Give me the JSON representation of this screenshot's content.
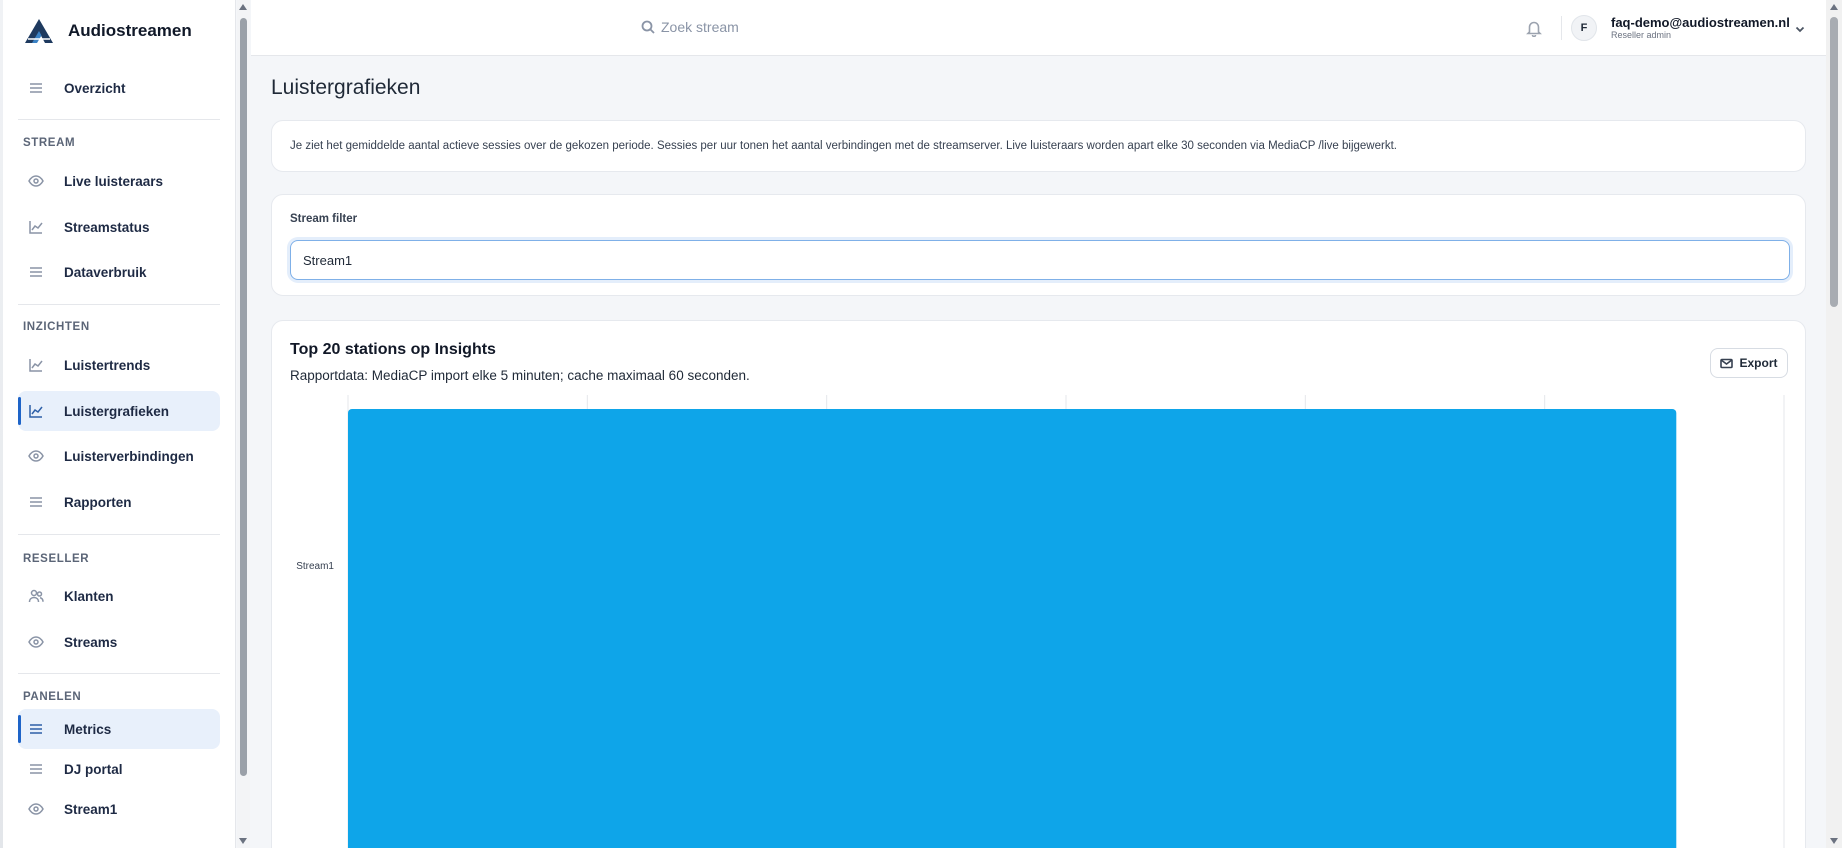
{
  "app": {
    "name": "Audiostreamen",
    "brand_color": "#1e3a5f"
  },
  "sidebar": {
    "overview": {
      "label": "Overzicht",
      "icon": "menu-icon"
    },
    "sections": [
      {
        "label": "STREAM",
        "items": [
          {
            "label": "Live luisteraars",
            "icon": "eye-icon"
          },
          {
            "label": "Streamstatus",
            "icon": "chart-line-icon"
          },
          {
            "label": "Dataverbruik",
            "icon": "menu-icon"
          }
        ]
      },
      {
        "label": "INZICHTEN",
        "items": [
          {
            "label": "Luistertrends",
            "icon": "chart-line-icon"
          },
          {
            "label": "Luistergrafieken",
            "icon": "chart-line-icon",
            "active": true
          },
          {
            "label": "Luisterverbindingen",
            "icon": "eye-icon"
          },
          {
            "label": "Rapporten",
            "icon": "menu-icon"
          }
        ]
      },
      {
        "label": "RESELLER",
        "items": [
          {
            "label": "Klanten",
            "icon": "users-icon"
          },
          {
            "label": "Streams",
            "icon": "eye-icon"
          }
        ]
      },
      {
        "label": "PANELEN",
        "items": [
          {
            "label": "Metrics",
            "icon": "menu-icon",
            "active": true
          },
          {
            "label": "DJ portal",
            "icon": "menu-icon"
          },
          {
            "label": "Stream1",
            "icon": "eye-icon"
          }
        ]
      }
    ]
  },
  "topbar": {
    "search_placeholder": "Zoek stream",
    "user": {
      "initial": "F",
      "email": "faq-demo@audiostreamen.nl",
      "role": "Reseller admin"
    }
  },
  "main": {
    "page_title": "Luistergrafieken",
    "info_text": "Je ziet het gemiddelde aantal actieve sessies over de gekozen periode. Sessies per uur tonen het aantal verbindingen met de streamserver. Live luisteraars worden apart elke 30 seconden via MediaCP /live bijgewerkt.",
    "filter": {
      "label": "Stream filter",
      "value": "Stream1"
    },
    "chart_card": {
      "title": "Top 20 stations op Insights",
      "subtitle": "Rapportdata: MediaCP import elke 5 minuten; cache maximaal 60 seconden.",
      "export_label": "Export"
    }
  },
  "chart_data": {
    "type": "bar",
    "orientation": "horizontal",
    "title": "Top 20 stations op Insights",
    "categories": [
      "Stream1"
    ],
    "values": [
      0.925
    ],
    "xlim": [
      0,
      1.0
    ],
    "grid": true,
    "bar_color": "#0ea5e9"
  }
}
